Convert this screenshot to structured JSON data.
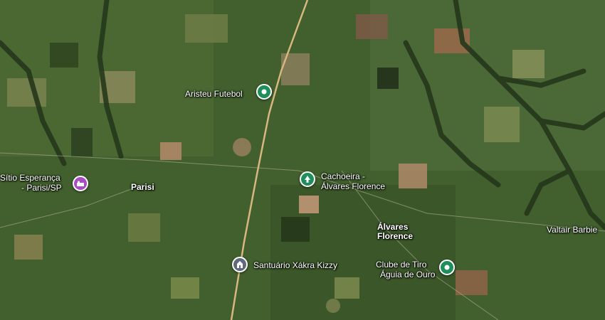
{
  "map": {
    "type": "satellite",
    "colors": {
      "pin_green": "#1e8e5a",
      "pin_purple": "#a94cc2",
      "pin_gray": "#5f6b7a"
    }
  },
  "places": {
    "aristeu": {
      "name": "Aristeu Futebol",
      "icon": "sport-field-icon"
    },
    "cachoeira": {
      "name_line1": "Cachoeira -",
      "name_line2": "Álvares Florence",
      "icon": "park-tree-icon"
    },
    "sitio": {
      "name_line1": "Sítio Esperança",
      "name_line2": "- Parisi/SP",
      "icon": "lodging-icon"
    },
    "santuario": {
      "name": "Santuário Xákra Kizzy",
      "icon": "religious-site-icon"
    },
    "clube": {
      "name_line1": "Clube de Tiro",
      "name_line2": "Águia de Ouro",
      "icon": "sport-field-icon"
    }
  },
  "towns": {
    "parisi": "Parisi",
    "alvares_line1": "Álvares",
    "alvares_line2": "Florence"
  },
  "roads": {
    "valtair": "Valtair Barbie"
  }
}
